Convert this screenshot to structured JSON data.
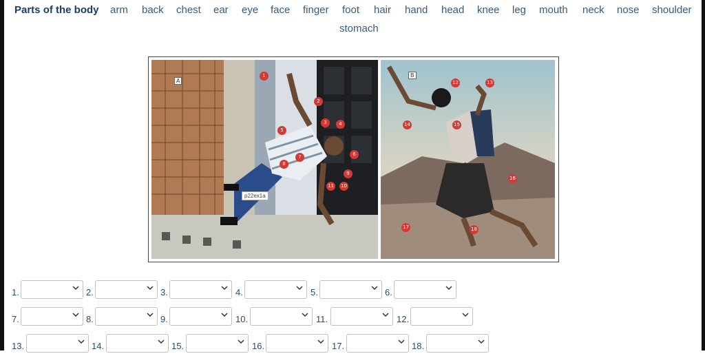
{
  "wordbank": {
    "title": "Parts of the body",
    "words": [
      "arm",
      "back",
      "chest",
      "ear",
      "eye",
      "face",
      "finger",
      "foot",
      "hair",
      "hand",
      "head",
      "knee",
      "leg",
      "mouth",
      "neck",
      "nose",
      "shoulder",
      "stomach"
    ]
  },
  "figure": {
    "panel_a_label": "A",
    "panel_b_label": "B",
    "caption": "p22ex1a",
    "markers_a": [
      "1",
      "2",
      "3",
      "4",
      "5",
      "6",
      "7",
      "8",
      "9",
      "10",
      "11"
    ],
    "markers_b": [
      "12",
      "13",
      "14",
      "15",
      "16",
      "17",
      "18"
    ]
  },
  "questions": {
    "labels": [
      "1.",
      "2.",
      "3.",
      "4.",
      "5.",
      "6.",
      "7.",
      "8.",
      "9.",
      "10.",
      "11.",
      "12.",
      "13.",
      "14.",
      "15.",
      "16.",
      "17.",
      "18."
    ]
  },
  "colors": {
    "link": "#3a5a7d",
    "title": "#1a3f66",
    "marker": "#d23a35"
  },
  "icons": {
    "dropdown": "chevron-down-icon"
  }
}
